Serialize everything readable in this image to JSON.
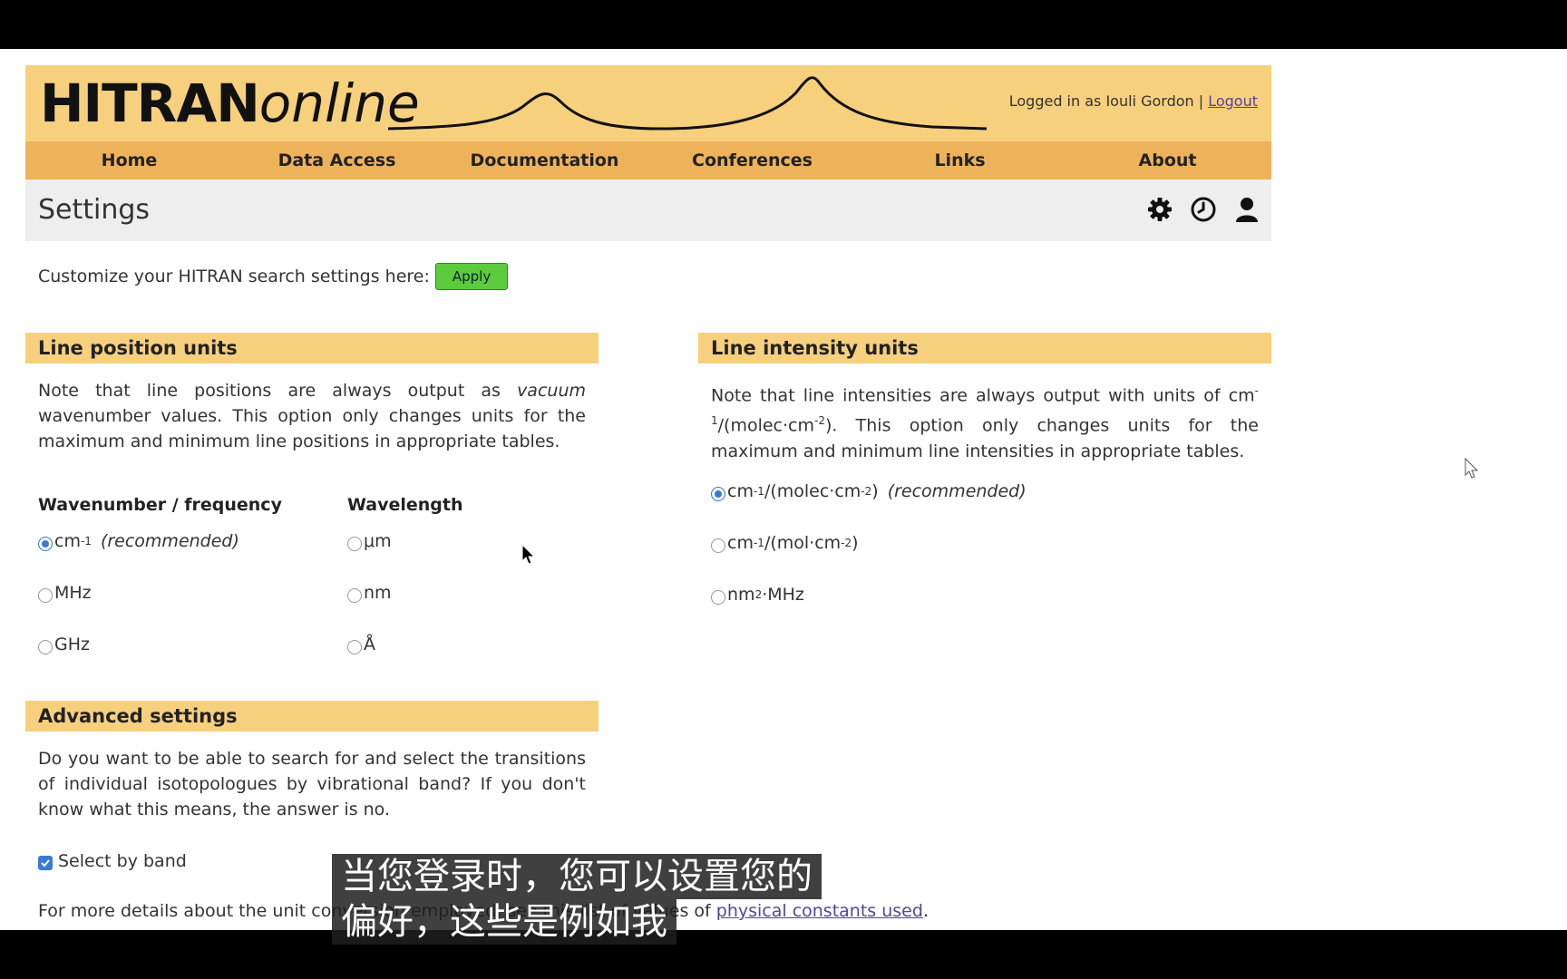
{
  "header": {
    "logo_bold": "HITRAN",
    "logo_italic": "online",
    "login_text": "Logged in as Iouli Gordon |",
    "logout": "Logout"
  },
  "nav": [
    "Home",
    "Data Access",
    "Documentation",
    "Conferences",
    "Links",
    "About"
  ],
  "page_title": "Settings",
  "toolbar_icons": [
    "gear-icon",
    "clock-icon",
    "user-icon"
  ],
  "customize": {
    "text": "Customize your HITRAN search settings here:",
    "apply_label": "Apply"
  },
  "line_position": {
    "heading": "Line position units",
    "note_before": "Note that line positions are always output as ",
    "note_italic": "vacuum",
    "note_after": " wavenumber values. This option only changes units for the maximum and minimum line positions in appropriate tables.",
    "col1_heading": "Wavenumber / frequency",
    "col2_heading": "Wavelength",
    "col1_options": [
      {
        "label": "cm",
        "sup": "-1",
        "note": "(recommended)",
        "selected": true
      },
      {
        "label": "MHz",
        "sup": "",
        "note": "",
        "selected": false
      },
      {
        "label": "GHz",
        "sup": "",
        "note": "",
        "selected": false
      }
    ],
    "col2_options": [
      {
        "label": "μm",
        "selected": false
      },
      {
        "label": "nm",
        "selected": false
      },
      {
        "label": "Å",
        "selected": false
      }
    ]
  },
  "line_intensity": {
    "heading": "Line intensity units",
    "note_a": "Note that line intensities are always output with units of",
    "note_b1": "cm",
    "note_b_sup1": "-1",
    "note_b2": "/(molec·cm",
    "note_b_sup2": "-2",
    "note_b3": "). This option only changes units for the maximum and minimum line intensities in appropriate tables.",
    "options": [
      {
        "p1": "cm",
        "s1": "-1",
        "p2": "/(molec·cm",
        "s2": "-2",
        "p3": ")",
        "note": "(recommended)",
        "selected": true
      },
      {
        "p1": "cm",
        "s1": "-1",
        "p2": "/(mol·cm",
        "s2": "-2",
        "p3": ")",
        "note": "",
        "selected": false
      },
      {
        "p1": "nm",
        "s1": "2",
        "p2": "·MHz",
        "s2": "",
        "p3": "",
        "note": "",
        "selected": false
      }
    ]
  },
  "advanced": {
    "heading": "Advanced settings",
    "note": "Do you want to be able to search for and select the transitions of individual isotopologues by vibrational band? If you don't know what this means, the answer is no.",
    "checkbox_label": "Select by band",
    "checked": true
  },
  "footer": {
    "text": "For more details about the unit conversion employed, see this list of values of",
    "link": "physical constants used",
    "end": "."
  },
  "subtitles": [
    "当您登录时，您可以设置您的",
    "偏好，这些是例如我"
  ]
}
